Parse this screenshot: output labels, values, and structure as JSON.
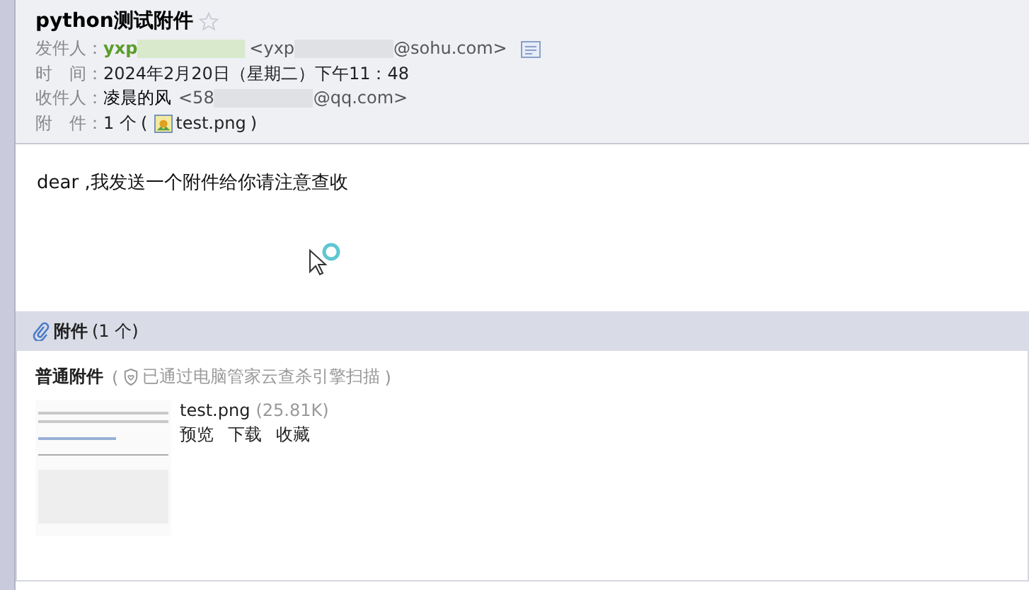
{
  "subject": "python测试附件",
  "starred": false,
  "fields": [
    {
      "kind": "sender",
      "label": "发件人：",
      "name": "yxp",
      "address_start": "<yxp",
      "address_end": "@sohu.com>"
    },
    {
      "kind": "plain",
      "label": "时　间：",
      "value": "2024年2月20日（星期二）下午11：48"
    },
    {
      "kind": "recipient",
      "label": "收件人：",
      "name": "凌晨的风",
      "address_start": "<58",
      "address_end": "@qq.com>"
    },
    {
      "kind": "attachment",
      "label": "附　件：",
      "count": "1 个",
      "open": "(",
      "file": "test.png",
      "close": ")"
    }
  ],
  "body": "dear ,我发送一个附件给你请注意查收",
  "attachments": {
    "title": "附件",
    "count": "(1 个)",
    "group": "普通附件",
    "scan_open": "(",
    "scan_note": "已通过电脑管家云查杀引擎扫描",
    "scan_close": ")",
    "items": [
      {
        "file": "test.png",
        "size": "(25.81K)",
        "actions": [
          "预览",
          "下载",
          "收藏"
        ]
      }
    ]
  }
}
